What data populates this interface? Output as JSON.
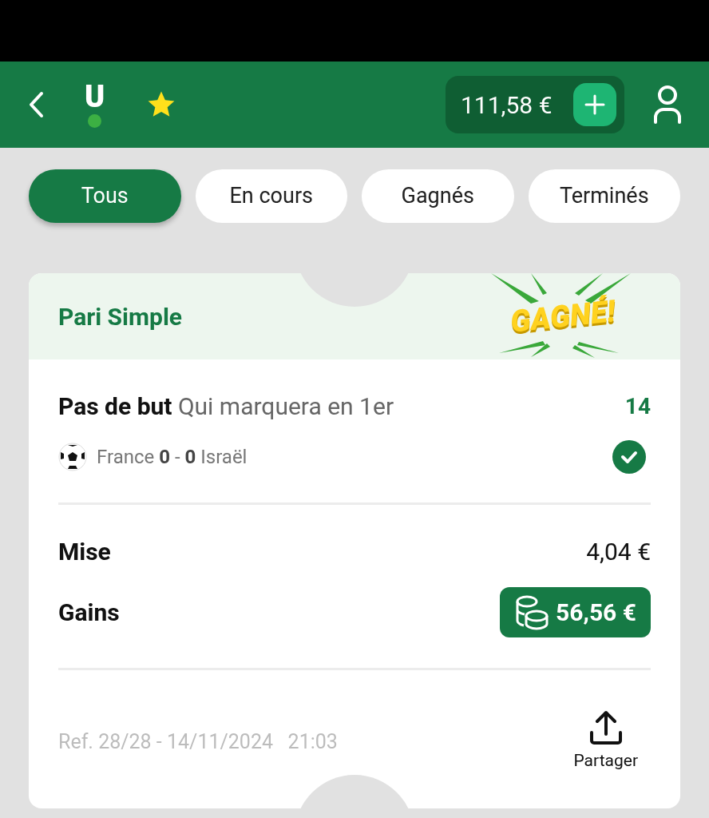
{
  "header": {
    "balance": "111,58 €",
    "logo": "U"
  },
  "tabs": [
    {
      "label": "Tous",
      "selected": true
    },
    {
      "label": "En cours",
      "selected": false
    },
    {
      "label": "Gagnés",
      "selected": false
    },
    {
      "label": "Terminés",
      "selected": false
    }
  ],
  "bet": {
    "type": "Pari Simple",
    "badge": "GAGNÉ!",
    "selection": "**Pas de but** Qui marquera en 1er",
    "odds": "14",
    "match": "France **0** - **0** Israël",
    "won": true,
    "stake_label": "Mise",
    "stake": "4,04 €",
    "gains_label": "Gains",
    "gains": "56,56 €",
    "reference": "Ref. 28/28 - 14/11/2024   21:03",
    "share": "Partager"
  }
}
